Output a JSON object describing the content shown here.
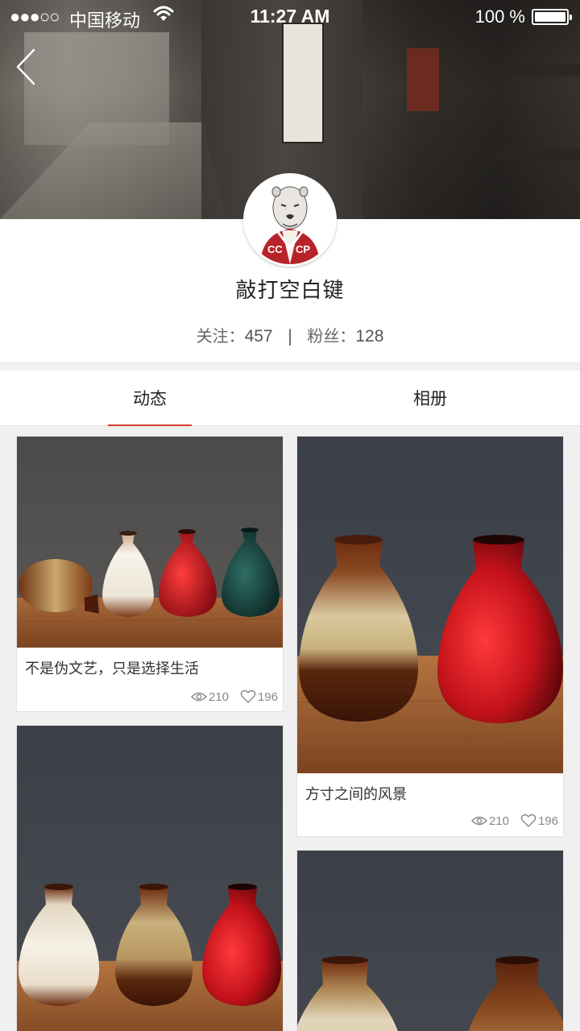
{
  "status_bar": {
    "signal": "●●●○○",
    "carrier": "中国移动",
    "time": "11:27 AM",
    "battery": "100 %"
  },
  "profile": {
    "username": "敲打空白键",
    "following_label": "关注：",
    "following_count": "457",
    "separator": "|",
    "followers_label": "粉丝：",
    "followers_count": "128"
  },
  "tabs": [
    {
      "label": "动态",
      "active": true
    },
    {
      "label": "相册",
      "active": false
    }
  ],
  "posts": [
    {
      "caption": "不是伪文艺，只是选择生活",
      "views": "210",
      "likes": "196"
    },
    {
      "caption": "方寸之间的风景",
      "views": "210",
      "likes": "196"
    }
  ],
  "colors": {
    "accent": "#d9392f",
    "vase_red": "#c4121b",
    "vase_teal": "#1e4a45",
    "vase_brown": "#5a2313",
    "vase_cream": "#f0ebe0",
    "table": "#8a4f26"
  }
}
